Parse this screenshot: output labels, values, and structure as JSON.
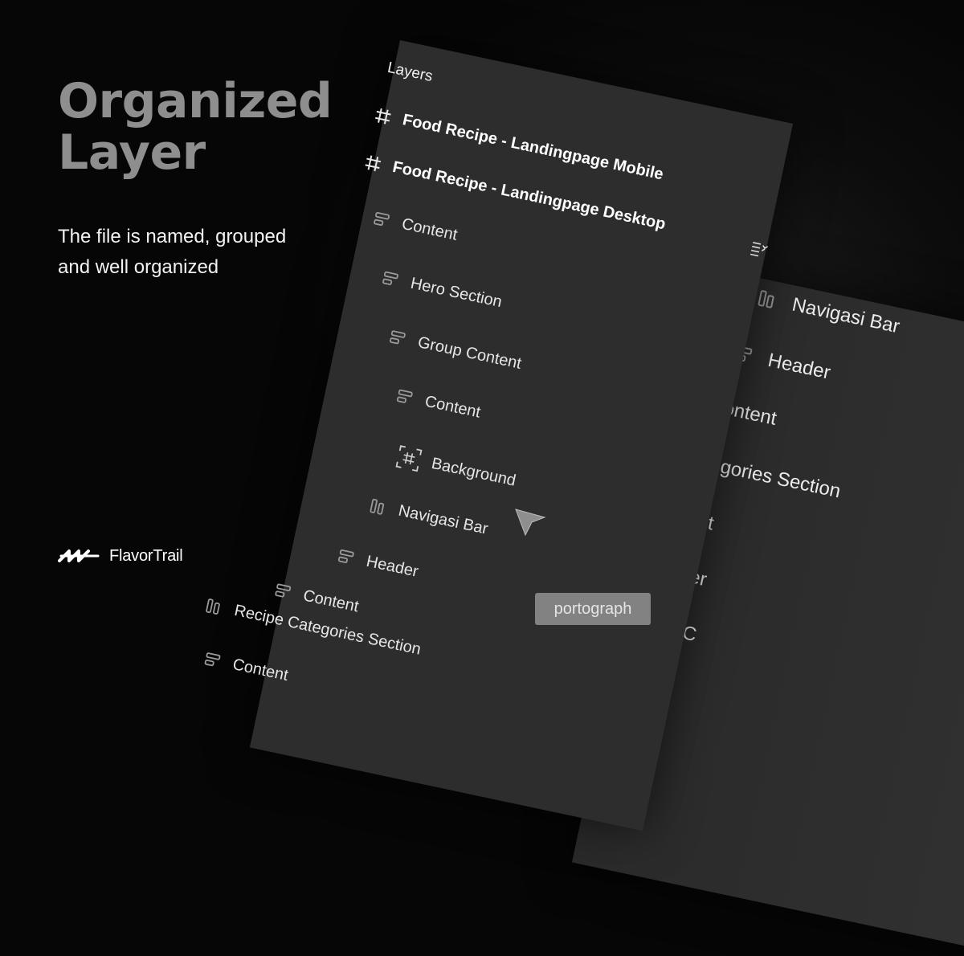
{
  "hero": {
    "title_line1": "Organized",
    "title_line2": "Layer",
    "subtitle_line1": "The file is named, grouped",
    "subtitle_line2": "and well organized"
  },
  "brand": {
    "name": "FlavorTrail",
    "icon": "flavortrail-logo-icon"
  },
  "layers_panel": {
    "title": "Layers",
    "menu_icon": "list-toggle-icon",
    "items": [
      {
        "label": "Food Recipe - Landingpage Mobile",
        "icon": "frame-hash-icon"
      },
      {
        "label": "Food Recipe - Landingpage Desktop",
        "icon": "frame-hash-icon"
      },
      {
        "label": "Content",
        "icon": "vertical-stack-icon"
      },
      {
        "label": "Hero Section",
        "icon": "vertical-stack-icon"
      },
      {
        "label": "Group Content",
        "icon": "vertical-stack-icon"
      },
      {
        "label": "Content",
        "icon": "vertical-stack-icon"
      },
      {
        "label": "Background",
        "icon": "frame-selected-icon"
      },
      {
        "label": "Navigasi Bar",
        "icon": "horizontal-stack-icon"
      },
      {
        "label": "Header",
        "icon": "vertical-stack-icon"
      },
      {
        "label": "Content",
        "icon": "vertical-stack-icon"
      },
      {
        "label": "Recipe Categories Section",
        "icon": "horizontal-stack-icon"
      },
      {
        "label": "Content",
        "icon": "vertical-stack-icon"
      }
    ]
  },
  "back_panel": {
    "items": [
      {
        "label": "Navigasi Bar",
        "icon": "horizontal-stack-icon"
      },
      {
        "label": "Header",
        "icon": "vertical-stack-icon"
      },
      {
        "label": "Content"
      },
      {
        "label": "Categories Section"
      },
      {
        "label": "ontent"
      },
      {
        "label": "Header"
      },
      {
        "label": "Group C"
      }
    ]
  },
  "cursor": {
    "icon": "pointer-cursor-icon"
  },
  "watermark": {
    "label": "portograph"
  },
  "colors": {
    "background": "#060606",
    "panel": "#2c2c2c",
    "headline": "#8e8e8e",
    "text": "#f2f2f2"
  }
}
